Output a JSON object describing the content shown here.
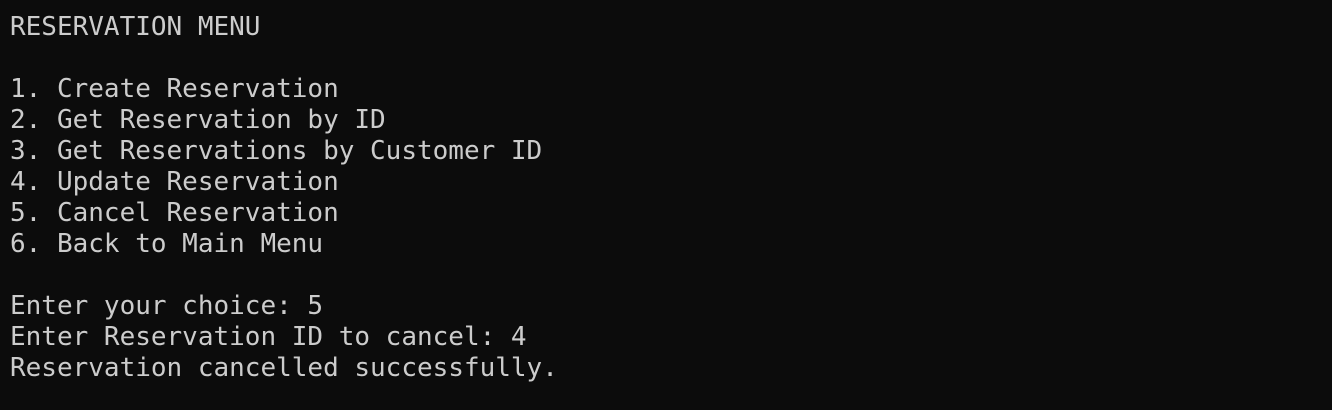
{
  "terminal": {
    "title_line": "RESERVATION MENU",
    "menu_items": [
      "1. Create Reservation",
      "2. Get Reservation by ID",
      "3. Get Reservations by Customer ID",
      "4. Update Reservation",
      "5. Cancel Reservation",
      "6. Back to Main Menu"
    ],
    "prompt_choice_label": "Enter your choice: ",
    "prompt_choice_value": "5",
    "prompt_id_label": "Enter Reservation ID to cancel: ",
    "prompt_id_value": "4",
    "result_message": "Reservation cancelled successfully."
  },
  "colors": {
    "background": "#0c0c0c",
    "text": "#cccccc"
  }
}
